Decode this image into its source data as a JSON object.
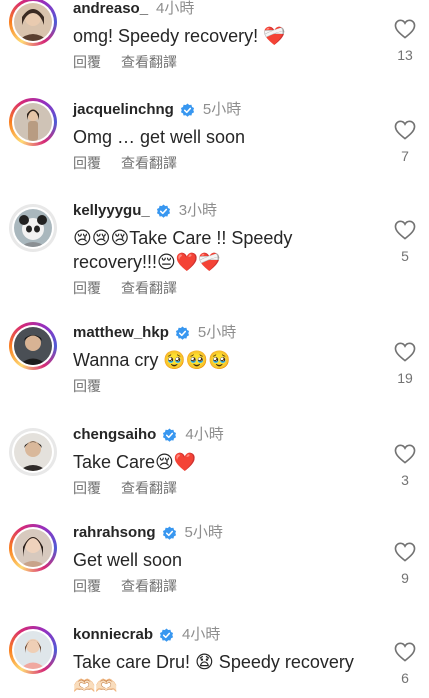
{
  "actions": {
    "reply_label": "回覆",
    "translate_label": "查看翻譯"
  },
  "colors": {
    "verified_blue": "#3897f0",
    "meta_gray": "#8e8e8e",
    "text_dark": "#262626"
  },
  "icons": {
    "like": "heart-outline-icon",
    "verified": "verified-badge-icon"
  },
  "comments": [
    {
      "username": "andreaso_",
      "verified": false,
      "time": "4小時",
      "text": "omg! Speedy recovery! ❤️‍🩹",
      "likes": "13",
      "has_translate": true
    },
    {
      "username": "jacquelinchng",
      "verified": true,
      "time": "5小時",
      "text": "Omg … get well soon",
      "likes": "7",
      "has_translate": true
    },
    {
      "username": "kellyyygu_",
      "verified": true,
      "time": "3小時",
      "text": "😢😢😢Take Care !! Speedy recovery!!!😔❤️❤️‍🩹",
      "likes": "5",
      "has_translate": true
    },
    {
      "username": "matthew_hkp",
      "verified": true,
      "time": "5小時",
      "text": "Wanna cry 🥹🥹🥹",
      "likes": "19",
      "has_translate": false
    },
    {
      "username": "chengsaiho",
      "verified": true,
      "time": "4小時",
      "text": "Take Care😢❤️",
      "likes": "3",
      "has_translate": true
    },
    {
      "username": "rahrahsong",
      "verified": true,
      "time": "5小時",
      "text": "Get well soon",
      "likes": "9",
      "has_translate": true
    },
    {
      "username": "konniecrab",
      "verified": true,
      "time": "4小時",
      "text": "Take care Dru! 😧 Speedy recovery 🫶🏻🫶🏻",
      "likes": "6",
      "has_translate": false
    }
  ]
}
